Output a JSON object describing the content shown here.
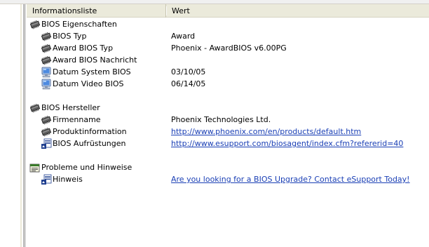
{
  "columns": {
    "info": "Informationsliste",
    "value": "Wert"
  },
  "groups": [
    {
      "title": "BIOS Eigenschaften",
      "icon": "chip-icon",
      "items": [
        {
          "label": "BIOS Typ",
          "value": "Award",
          "icon": "chip-icon",
          "link": false
        },
        {
          "label": "Award BIOS Typ",
          "value": "Phoenix - AwardBIOS v6.00PG",
          "icon": "chip-icon",
          "link": false
        },
        {
          "label": "Award BIOS Nachricht",
          "value": "",
          "icon": "chip-icon",
          "link": false
        },
        {
          "label": "Datum System BIOS",
          "value": "03/10/05",
          "icon": "monitor-icon",
          "link": false
        },
        {
          "label": "Datum Video BIOS",
          "value": "06/14/05",
          "icon": "monitor-icon",
          "link": false
        }
      ]
    },
    {
      "title": "BIOS Hersteller",
      "icon": "chip-icon",
      "items": [
        {
          "label": "Firmenname",
          "value": "Phoenix Technologies Ltd.",
          "icon": "chip-icon",
          "link": false
        },
        {
          "label": "Produktinformation",
          "value": "http://www.phoenix.com/en/products/default.htm",
          "icon": "chip-icon",
          "link": true
        },
        {
          "label": "BIOS Aufrüstungen",
          "value": "http://www.esupport.com/biosagent/index.cfm?refererid=40",
          "icon": "update-icon",
          "link": true
        }
      ]
    },
    {
      "title": "Probleme und Hinweise",
      "icon": "notes-icon",
      "items": [
        {
          "label": "Hinweis",
          "value": "Are you looking for a BIOS Upgrade?  Contact eSupport Today!",
          "icon": "update-icon",
          "link": true
        }
      ]
    }
  ],
  "colors": {
    "link": "#1a3fb5",
    "header_bg": "#ebeadb"
  }
}
